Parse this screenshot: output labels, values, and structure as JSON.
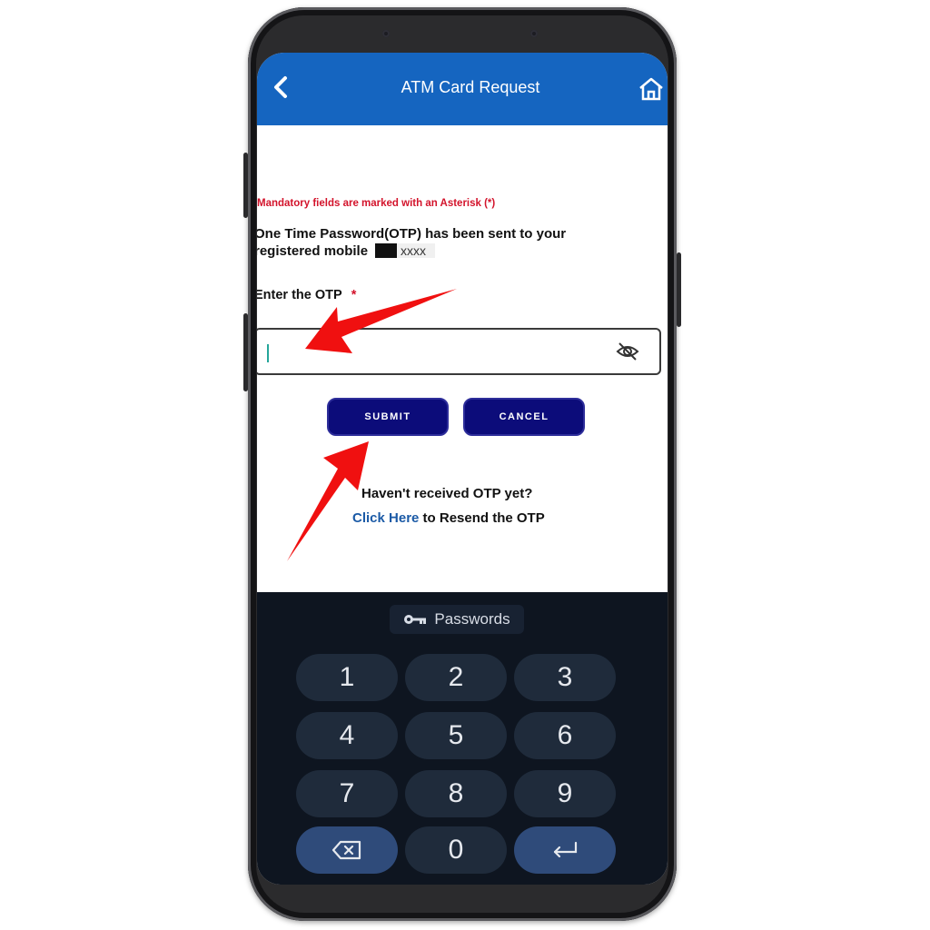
{
  "app": {
    "title": "ATM Card Request"
  },
  "form": {
    "mandatory_note": "Mandatory fields are marked with an Asterisk (*)",
    "otp_message_line1": "One Time Password(OTP) has been sent to your",
    "otp_message_line2": "registered mobile",
    "masked_number_suffix": "xxxx",
    "otp_label": "Enter the OTP",
    "required_mark": "*",
    "otp_value": ""
  },
  "buttons": {
    "submit": "SUBMIT",
    "cancel": "CANCEL"
  },
  "resend": {
    "question": "Haven't received OTP yet?",
    "link": "Click Here",
    "suffix": " to Resend the OTP"
  },
  "keyboard": {
    "suggestion": "Passwords",
    "keys": [
      "1",
      "2",
      "3",
      "4",
      "5",
      "6",
      "7",
      "8",
      "9",
      "0"
    ],
    "icons": {
      "delete": "backspace-icon",
      "enter": "enter-icon",
      "key": "key-icon"
    }
  },
  "colors": {
    "appbar": "#1565c0",
    "button": "#0c0c7a",
    "required": "#d3132b",
    "link": "#1b5aa6",
    "keyboard": "#0e1520",
    "arrow": "#f01010"
  }
}
